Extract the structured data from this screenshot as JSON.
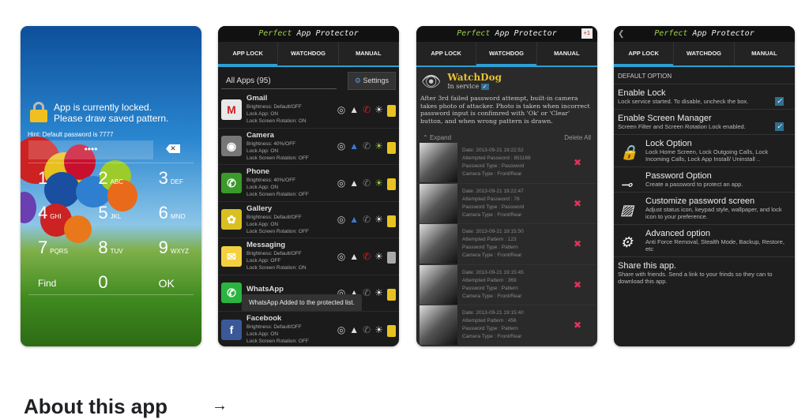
{
  "lock_screen": {
    "message": "App is currently locked. Please draw saved pattern.",
    "hint": "Hint: Default password is 7777",
    "password_mask": "••••",
    "keys": [
      {
        "d": "1",
        "l": ""
      },
      {
        "d": "2",
        "l": "ABC"
      },
      {
        "d": "3",
        "l": "DEF"
      },
      {
        "d": "4",
        "l": "GHI"
      },
      {
        "d": "5",
        "l": "JKL"
      },
      {
        "d": "6",
        "l": "MNO"
      },
      {
        "d": "7",
        "l": "PQRS"
      },
      {
        "d": "8",
        "l": "TUV"
      },
      {
        "d": "9",
        "l": "WXYZ"
      }
    ],
    "find": "Find",
    "zero": "0",
    "ok": "OK"
  },
  "app": {
    "title_a": "Perfect",
    "title_b": " App Protector",
    "tabs": [
      "APP LOCK",
      "WATCHDOG",
      "MANUAL"
    ]
  },
  "applock": {
    "filter": "All Apps (95)",
    "settings": "Settings",
    "toast": "WhatsApp Added to the protected list.",
    "apps": [
      {
        "name": "Gmail",
        "l1": "Brightness: Default/OFF",
        "l2": "Lock App: ON",
        "l3": "Lock Screen Rotation: ON",
        "color": "#e8e8e8",
        "g": "M",
        "locked": true
      },
      {
        "name": "Camera",
        "l1": "Brightness: 40%/OFF",
        "l2": "Lock App: ON",
        "l3": "Lock Screen Rotation: OFF",
        "color": "#777",
        "g": "◉",
        "locked": true
      },
      {
        "name": "Phone",
        "l1": "Brightness: 40%/OFF",
        "l2": "Lock App: ON",
        "l3": "Lock Screen Rotation: OFF",
        "color": "#3a9a2a",
        "g": "✆",
        "locked": true
      },
      {
        "name": "Gallery",
        "l1": "Brightness: Default/OFF",
        "l2": "Lock App: ON",
        "l3": "Lock Screen Rotation: OFF",
        "color": "#d8c020",
        "g": "✿",
        "locked": true
      },
      {
        "name": "Messaging",
        "l1": "Brightness: Default/OFF",
        "l2": "Lock App: OFF",
        "l3": "Lock Screen Rotation: ON",
        "color": "#f3d040",
        "g": "✉",
        "locked": false
      },
      {
        "name": "WhatsApp",
        "l1": "Brightness: Default/OFF",
        "l2": "",
        "l3": "",
        "color": "#2ab540",
        "g": "✆",
        "locked": true
      },
      {
        "name": "Facebook",
        "l1": "Brightness: Default/OFF",
        "l2": "Lock App: ON",
        "l3": "Lock Screen Rotation: OFF",
        "color": "#3b5998",
        "g": "f",
        "locked": true
      }
    ]
  },
  "watchdog": {
    "title": "WatchDog",
    "in_service": "In service",
    "description": "After 3rd failed password attempt, built-in camera takes photo of attacker. Photo is taken when incorrect password input is confimred with 'Ok' or 'Clear' button, and when wrong pattern is drawn.",
    "expand": "Expand",
    "delete_all": "Delete All",
    "gplus": "+1",
    "attempts": [
      {
        "date": "Date: 2013-09-21 19:22:52",
        "attempt": "Attempted Password : 851168",
        "type": "Password Type : Password",
        "camera": "Camera Type : Front/Rear"
      },
      {
        "date": "Date: 2013-09-21 19:22:47",
        "attempt": "Attempted Password : 78",
        "type": "Password Type : Password",
        "camera": "Camera Type : Front/Rear"
      },
      {
        "date": "Date: 2013-09-21 19:15:50",
        "attempt": "Attempted Pattern : 123",
        "type": "Password Type : Pattern",
        "camera": "Camera Type : Front/Rear"
      },
      {
        "date": "Date: 2013-09-21 19:15:45",
        "attempt": "Attempted Pattern : 369",
        "type": "Password Type : Pattern",
        "camera": "Camera Type : Front/Rear"
      },
      {
        "date": "Date: 2013-09-21 19:15:40",
        "attempt": "Attempted Pattern : 456",
        "type": "Password Type : Pattern",
        "camera": "Camera Type : Front/Rear"
      }
    ]
  },
  "settings": {
    "section": "DEFAULT OPTION",
    "enable_lock": {
      "title": "Enable Lock",
      "desc": "Lock service started. To disable, uncheck the box.",
      "checked": true
    },
    "enable_screen": {
      "title": "Enable Screen Manager",
      "desc": "Screen Filter and Screen Rotation Lock enabled.",
      "checked": true
    },
    "options": [
      {
        "title": "Lock Option",
        "desc": "Lock Home Screen, Lock Outgoing Calls, Lock Incoming Calls, Lock App Install/ Uninstall ..",
        "icon": "lock-icon",
        "g": "🔒"
      },
      {
        "title": "Password Option",
        "desc": "Create a password to protect an app.",
        "icon": "key-icon",
        "g": "⊸"
      },
      {
        "title": "Customize password screen",
        "desc": "Adjust status icon, keypad style, wallpaper, and lock icon to your preference.",
        "icon": "image-icon",
        "g": "▨"
      },
      {
        "title": "Advanced option",
        "desc": "Anti Force Removal, Stealth Mode, Backup, Restore, etc",
        "icon": "gear-icon",
        "g": "⚙"
      }
    ],
    "share": {
      "title": "Share this app.",
      "desc": "Share with friends. Send a link to your frinds so they can to download this app."
    }
  },
  "about": {
    "heading": "About this app"
  }
}
